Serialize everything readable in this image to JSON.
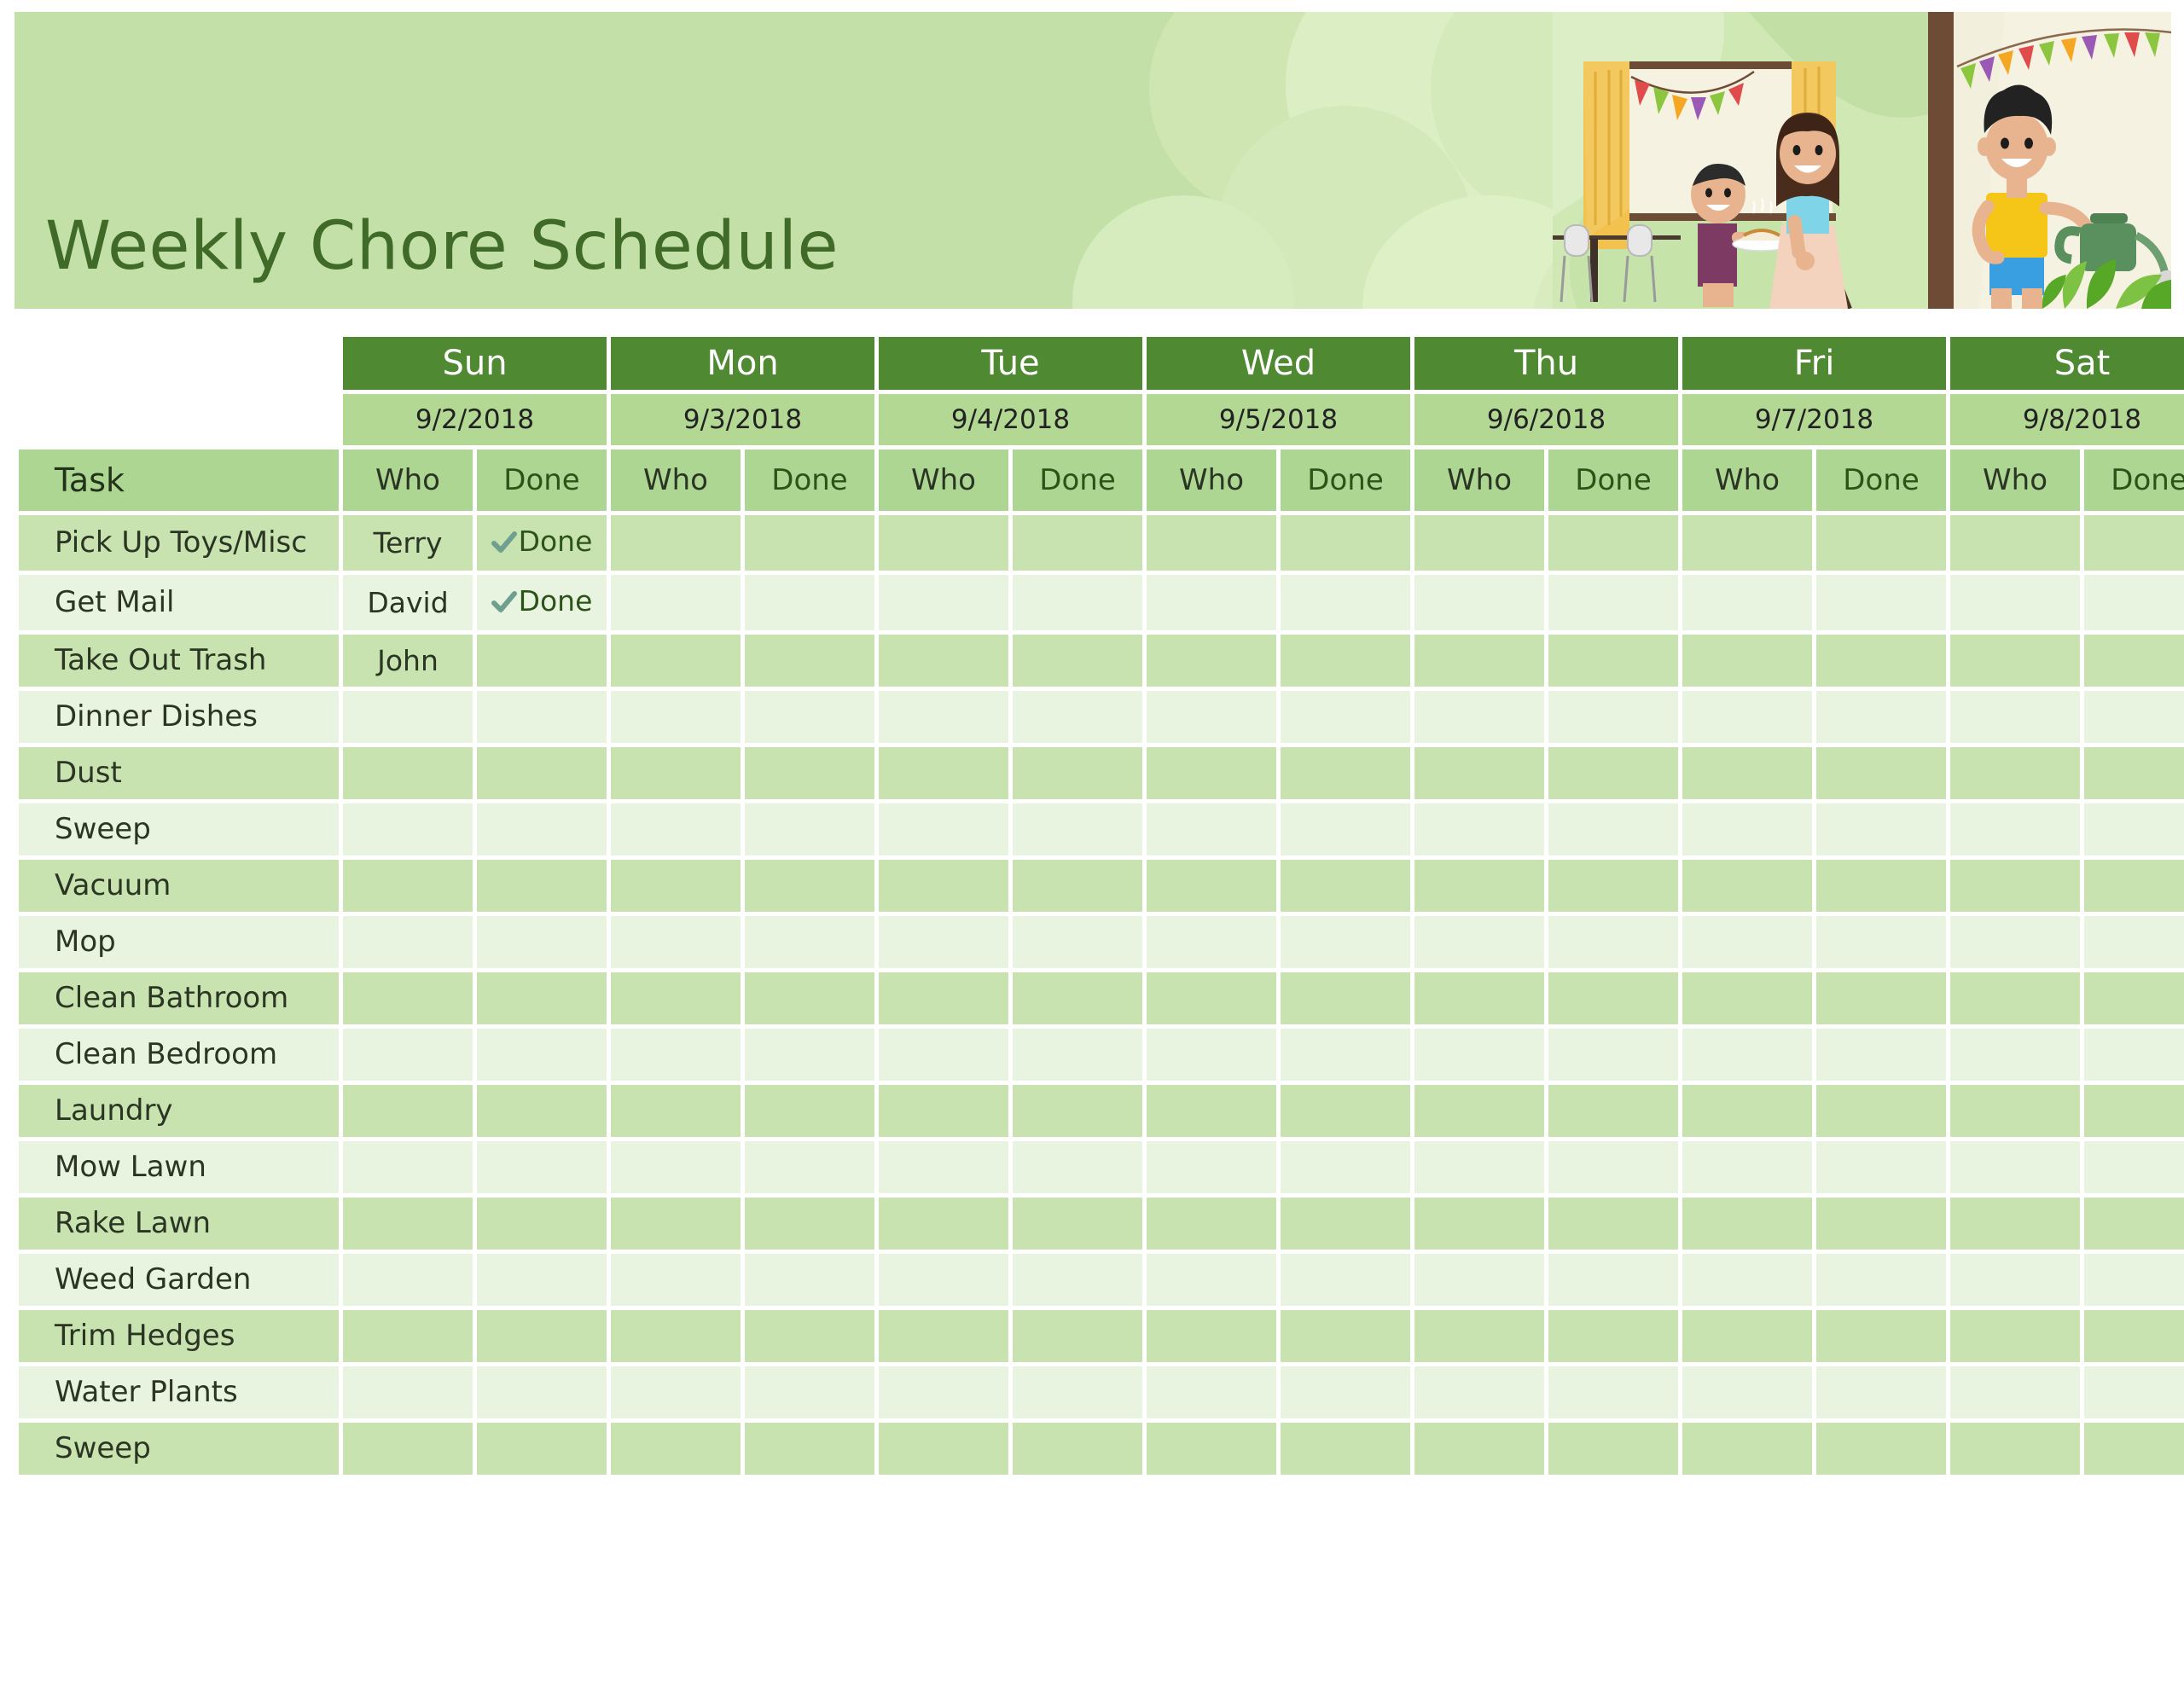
{
  "banner": {
    "title": "Weekly Chore Schedule",
    "bg_color": "#c3e0a8",
    "title_color": "#3f6a28"
  },
  "illustration": {
    "name": "family-chores-illustration",
    "scene_elements": [
      "bunting-flags",
      "curtain",
      "window",
      "mother-sweeping",
      "boy-with-cake",
      "boy-watering-plants",
      "potted-plant",
      "table-and-chairs"
    ]
  },
  "table": {
    "task_header": "Task",
    "who_header": "Who",
    "done_header": "Done",
    "done_label": "Done",
    "check_color": "#6f9f8f",
    "header_bg": "#4f8a33",
    "date_bg": "#b3d893",
    "subheader_bg": "#aed693",
    "row_a_bg": "#c9e3b0",
    "row_b_bg": "#e9f4e0",
    "days": [
      {
        "name": "Sun",
        "date": "9/2/2018"
      },
      {
        "name": "Mon",
        "date": "9/3/2018"
      },
      {
        "name": "Tue",
        "date": "9/4/2018"
      },
      {
        "name": "Wed",
        "date": "9/5/2018"
      },
      {
        "name": "Thu",
        "date": "9/6/2018"
      },
      {
        "name": "Fri",
        "date": "9/7/2018"
      },
      {
        "name": "Sat",
        "date": "9/8/2018"
      }
    ],
    "rows": [
      {
        "task": "Pick Up Toys/Misc",
        "cells": [
          {
            "who": "Terry",
            "done": "Done"
          },
          {
            "who": "",
            "done": ""
          },
          {
            "who": "",
            "done": ""
          },
          {
            "who": "",
            "done": ""
          },
          {
            "who": "",
            "done": ""
          },
          {
            "who": "",
            "done": ""
          },
          {
            "who": "",
            "done": ""
          }
        ]
      },
      {
        "task": "Get Mail",
        "cells": [
          {
            "who": "David",
            "done": "Done"
          },
          {
            "who": "",
            "done": ""
          },
          {
            "who": "",
            "done": ""
          },
          {
            "who": "",
            "done": ""
          },
          {
            "who": "",
            "done": ""
          },
          {
            "who": "",
            "done": ""
          },
          {
            "who": "",
            "done": ""
          }
        ]
      },
      {
        "task": "Take Out Trash",
        "cells": [
          {
            "who": "John",
            "done": ""
          },
          {
            "who": "",
            "done": ""
          },
          {
            "who": "",
            "done": ""
          },
          {
            "who": "",
            "done": ""
          },
          {
            "who": "",
            "done": ""
          },
          {
            "who": "",
            "done": ""
          },
          {
            "who": "",
            "done": ""
          }
        ]
      },
      {
        "task": "Dinner Dishes",
        "cells": [
          {
            "who": "",
            "done": ""
          },
          {
            "who": "",
            "done": ""
          },
          {
            "who": "",
            "done": ""
          },
          {
            "who": "",
            "done": ""
          },
          {
            "who": "",
            "done": ""
          },
          {
            "who": "",
            "done": ""
          },
          {
            "who": "",
            "done": ""
          }
        ]
      },
      {
        "task": "Dust",
        "cells": [
          {
            "who": "",
            "done": ""
          },
          {
            "who": "",
            "done": ""
          },
          {
            "who": "",
            "done": ""
          },
          {
            "who": "",
            "done": ""
          },
          {
            "who": "",
            "done": ""
          },
          {
            "who": "",
            "done": ""
          },
          {
            "who": "",
            "done": ""
          }
        ]
      },
      {
        "task": "Sweep",
        "cells": [
          {
            "who": "",
            "done": ""
          },
          {
            "who": "",
            "done": ""
          },
          {
            "who": "",
            "done": ""
          },
          {
            "who": "",
            "done": ""
          },
          {
            "who": "",
            "done": ""
          },
          {
            "who": "",
            "done": ""
          },
          {
            "who": "",
            "done": ""
          }
        ]
      },
      {
        "task": "Vacuum",
        "cells": [
          {
            "who": "",
            "done": ""
          },
          {
            "who": "",
            "done": ""
          },
          {
            "who": "",
            "done": ""
          },
          {
            "who": "",
            "done": ""
          },
          {
            "who": "",
            "done": ""
          },
          {
            "who": "",
            "done": ""
          },
          {
            "who": "",
            "done": ""
          }
        ]
      },
      {
        "task": "Mop",
        "cells": [
          {
            "who": "",
            "done": ""
          },
          {
            "who": "",
            "done": ""
          },
          {
            "who": "",
            "done": ""
          },
          {
            "who": "",
            "done": ""
          },
          {
            "who": "",
            "done": ""
          },
          {
            "who": "",
            "done": ""
          },
          {
            "who": "",
            "done": ""
          }
        ]
      },
      {
        "task": "Clean Bathroom",
        "cells": [
          {
            "who": "",
            "done": ""
          },
          {
            "who": "",
            "done": ""
          },
          {
            "who": "",
            "done": ""
          },
          {
            "who": "",
            "done": ""
          },
          {
            "who": "",
            "done": ""
          },
          {
            "who": "",
            "done": ""
          },
          {
            "who": "",
            "done": ""
          }
        ]
      },
      {
        "task": "Clean Bedroom",
        "cells": [
          {
            "who": "",
            "done": ""
          },
          {
            "who": "",
            "done": ""
          },
          {
            "who": "",
            "done": ""
          },
          {
            "who": "",
            "done": ""
          },
          {
            "who": "",
            "done": ""
          },
          {
            "who": "",
            "done": ""
          },
          {
            "who": "",
            "done": ""
          }
        ]
      },
      {
        "task": "Laundry",
        "cells": [
          {
            "who": "",
            "done": ""
          },
          {
            "who": "",
            "done": ""
          },
          {
            "who": "",
            "done": ""
          },
          {
            "who": "",
            "done": ""
          },
          {
            "who": "",
            "done": ""
          },
          {
            "who": "",
            "done": ""
          },
          {
            "who": "",
            "done": ""
          }
        ]
      },
      {
        "task": "Mow Lawn",
        "cells": [
          {
            "who": "",
            "done": ""
          },
          {
            "who": "",
            "done": ""
          },
          {
            "who": "",
            "done": ""
          },
          {
            "who": "",
            "done": ""
          },
          {
            "who": "",
            "done": ""
          },
          {
            "who": "",
            "done": ""
          },
          {
            "who": "",
            "done": ""
          }
        ]
      },
      {
        "task": "Rake Lawn",
        "cells": [
          {
            "who": "",
            "done": ""
          },
          {
            "who": "",
            "done": ""
          },
          {
            "who": "",
            "done": ""
          },
          {
            "who": "",
            "done": ""
          },
          {
            "who": "",
            "done": ""
          },
          {
            "who": "",
            "done": ""
          },
          {
            "who": "",
            "done": ""
          }
        ]
      },
      {
        "task": "Weed Garden",
        "cells": [
          {
            "who": "",
            "done": ""
          },
          {
            "who": "",
            "done": ""
          },
          {
            "who": "",
            "done": ""
          },
          {
            "who": "",
            "done": ""
          },
          {
            "who": "",
            "done": ""
          },
          {
            "who": "",
            "done": ""
          },
          {
            "who": "",
            "done": ""
          }
        ]
      },
      {
        "task": "Trim Hedges",
        "cells": [
          {
            "who": "",
            "done": ""
          },
          {
            "who": "",
            "done": ""
          },
          {
            "who": "",
            "done": ""
          },
          {
            "who": "",
            "done": ""
          },
          {
            "who": "",
            "done": ""
          },
          {
            "who": "",
            "done": ""
          },
          {
            "who": "",
            "done": ""
          }
        ]
      },
      {
        "task": "Water Plants",
        "cells": [
          {
            "who": "",
            "done": ""
          },
          {
            "who": "",
            "done": ""
          },
          {
            "who": "",
            "done": ""
          },
          {
            "who": "",
            "done": ""
          },
          {
            "who": "",
            "done": ""
          },
          {
            "who": "",
            "done": ""
          },
          {
            "who": "",
            "done": ""
          }
        ]
      },
      {
        "task": "Sweep",
        "cells": [
          {
            "who": "",
            "done": ""
          },
          {
            "who": "",
            "done": ""
          },
          {
            "who": "",
            "done": ""
          },
          {
            "who": "",
            "done": ""
          },
          {
            "who": "",
            "done": ""
          },
          {
            "who": "",
            "done": ""
          },
          {
            "who": "",
            "done": ""
          }
        ]
      }
    ]
  }
}
